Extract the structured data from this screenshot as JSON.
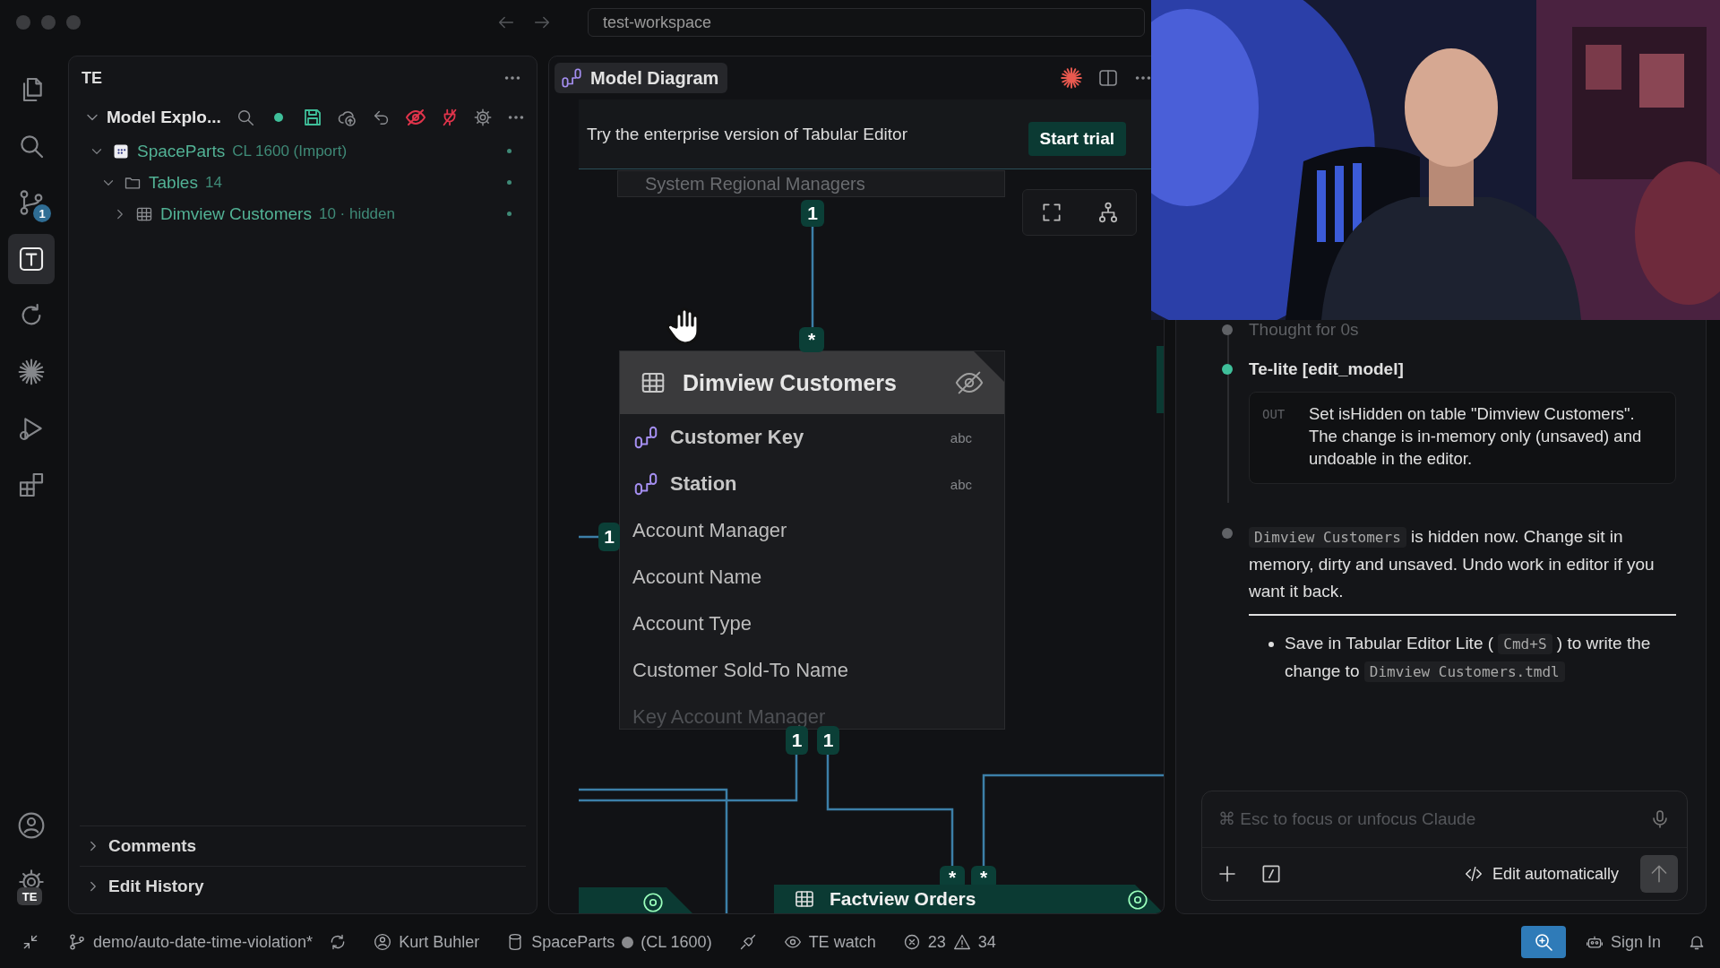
{
  "window": {
    "address": "test-workspace"
  },
  "activity_bar": {
    "items": [
      {
        "kind": "files",
        "selected": false
      },
      {
        "kind": "search",
        "selected": false
      },
      {
        "kind": "source_control",
        "selected": false,
        "badge": "1"
      },
      {
        "kind": "tabular_editor",
        "selected": true
      },
      {
        "kind": "refresh",
        "selected": false
      },
      {
        "kind": "sparkle",
        "selected": false
      },
      {
        "kind": "run",
        "selected": false
      },
      {
        "kind": "extensions",
        "selected": false
      }
    ],
    "bottom": [
      {
        "kind": "account"
      },
      {
        "kind": "settings",
        "badge": "TE"
      }
    ]
  },
  "explorer": {
    "title": "TE",
    "section": {
      "label": "Model Explo...",
      "expanded": true
    },
    "tree": [
      {
        "label": "SpaceParts",
        "detail": "CL 1600 (Import)",
        "kind": "model",
        "expanded": true,
        "children": [
          {
            "label": "Tables",
            "detail": "14",
            "kind": "folder",
            "expanded": true,
            "children": [
              {
                "label": "Dimview Customers",
                "detail": "10 · hidden",
                "kind": "table",
                "expanded": false
              }
            ]
          }
        ]
      }
    ],
    "sections": [
      {
        "label": "Comments",
        "expanded": false
      },
      {
        "label": "Edit History",
        "expanded": false
      }
    ]
  },
  "editor": {
    "tab": {
      "label": "Model Diagram",
      "selected": true
    },
    "banner": {
      "text": "Try the enterprise version of Tabular Editor",
      "button": "Start trial"
    },
    "diagram": {
      "upper_table": "System Regional Managers",
      "table": {
        "name": "Dimview Customers",
        "hidden": true,
        "columns": [
          {
            "name": "Customer Key",
            "kind": "key",
            "type": "abc"
          },
          {
            "name": "Station",
            "kind": "key",
            "type": "abc"
          },
          {
            "name": "Account Manager",
            "kind": "plain"
          },
          {
            "name": "Account Name",
            "kind": "plain"
          },
          {
            "name": "Account Type",
            "kind": "plain"
          },
          {
            "name": "Customer Sold-To Name",
            "kind": "plain"
          },
          {
            "name": "Key Account Manager",
            "kind": "plain"
          }
        ]
      },
      "lower_table": "Factview Orders",
      "cardinalities": [
        "1",
        "*",
        "1",
        "1",
        "1",
        "*",
        "*"
      ]
    }
  },
  "chat": {
    "timeline": [
      {
        "kind": "thought",
        "text": "Thought for 0s",
        "color": "#606266"
      },
      {
        "kind": "tool",
        "title": "Te-lite [edit_model]",
        "color": "#3fbf9a",
        "output_label": "OUT",
        "output": "Set isHidden on table \"Dimview Customers\". The change is in-memory only (unsaved) and undoable in the editor."
      },
      {
        "kind": "reply",
        "code": "Dimview Customers",
        "text": "is hidden now. Change sit in memory, dirty and unsaved. Undo work in editor if you want it back.",
        "color": "#606266"
      }
    ],
    "bullets": [
      {
        "parts": [
          {
            "kind": "text",
            "text": "Save in Tabular Editor Lite ("
          },
          {
            "kind": "code",
            "text": "Cmd+S"
          },
          {
            "kind": "text",
            "text": ") to write the change to"
          },
          {
            "kind": "code",
            "text": "Dimview Customers.tmdl"
          }
        ]
      }
    ],
    "input": {
      "placeholder": "⌘ Esc to focus or unfocus Claude"
    },
    "mode": "Edit automatically"
  },
  "status_bar": {
    "branch": "demo/auto-date-time-violation*",
    "user": "Kurt Buhler",
    "model": "SpaceParts",
    "connected": false,
    "model_detail": "(CL 1600)",
    "watch": "TE watch",
    "errors": "23",
    "warnings": "34",
    "zoom_active": true,
    "sign_in": "Sign In"
  }
}
